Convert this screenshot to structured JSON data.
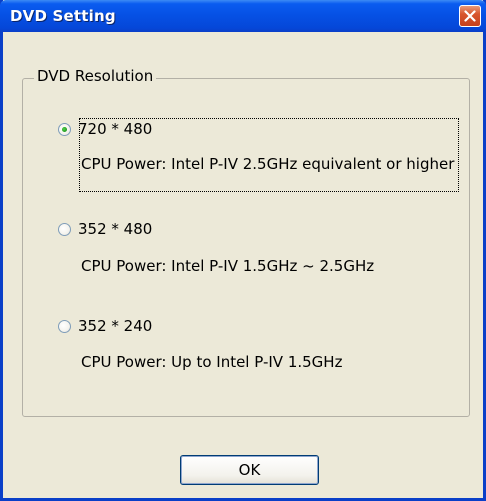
{
  "window": {
    "title": "DVD Setting",
    "close_icon": "close-icon",
    "accent_color": "#0a5cf0",
    "close_color": "#c7411d"
  },
  "group": {
    "legend": "DVD Resolution"
  },
  "options": [
    {
      "label": "720 * 480",
      "description": "CPU Power: Intel P-IV 2.5GHz equivalent or higher",
      "checked": true
    },
    {
      "label": "352 * 480",
      "description": "CPU Power: Intel P-IV 1.5GHz ~ 2.5GHz",
      "checked": false
    },
    {
      "label": "352 * 240",
      "description": "CPU Power: Up to Intel P-IV 1.5GHz",
      "checked": false
    }
  ],
  "buttons": {
    "ok_label": "OK"
  }
}
